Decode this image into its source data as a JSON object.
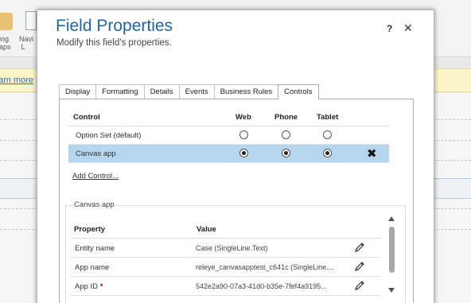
{
  "background": {
    "ribbon_labels": [
      "ing\naps",
      "Navi\nL"
    ],
    "learn_more": "arn more"
  },
  "dialog": {
    "title": "Field Properties",
    "subtitle": "Modify this field's properties.",
    "help": "?",
    "close": "✕"
  },
  "tabs": [
    "Display",
    "Formatting",
    "Details",
    "Events",
    "Business Rules",
    "Controls"
  ],
  "active_tab": "Controls",
  "controls": {
    "headers": {
      "control": "Control",
      "web": "Web",
      "phone": "Phone",
      "tablet": "Tablet"
    },
    "rows": [
      {
        "name": "Option Set (default)",
        "web": false,
        "phone": false,
        "tablet": false,
        "selected": false
      },
      {
        "name": "Canvas app",
        "web": true,
        "phone": true,
        "tablet": true,
        "selected": true
      }
    ],
    "remove_icon": "✖",
    "add_control": "Add Control..."
  },
  "canvas_app": {
    "legend": "Canvas app",
    "headers": {
      "property": "Property",
      "value": "Value"
    },
    "rows": [
      {
        "name": "Entity name",
        "value": "Case (SingleLine.Text)",
        "required": false
      },
      {
        "name": "App name",
        "value": "releye_canvasapptest_c641c (SingleLine....",
        "required": false
      },
      {
        "name": "App ID",
        "value": "542e2a90-07a3-41d0-b35e-7fef4a9195...",
        "required": true
      }
    ],
    "required_marker": "*"
  }
}
